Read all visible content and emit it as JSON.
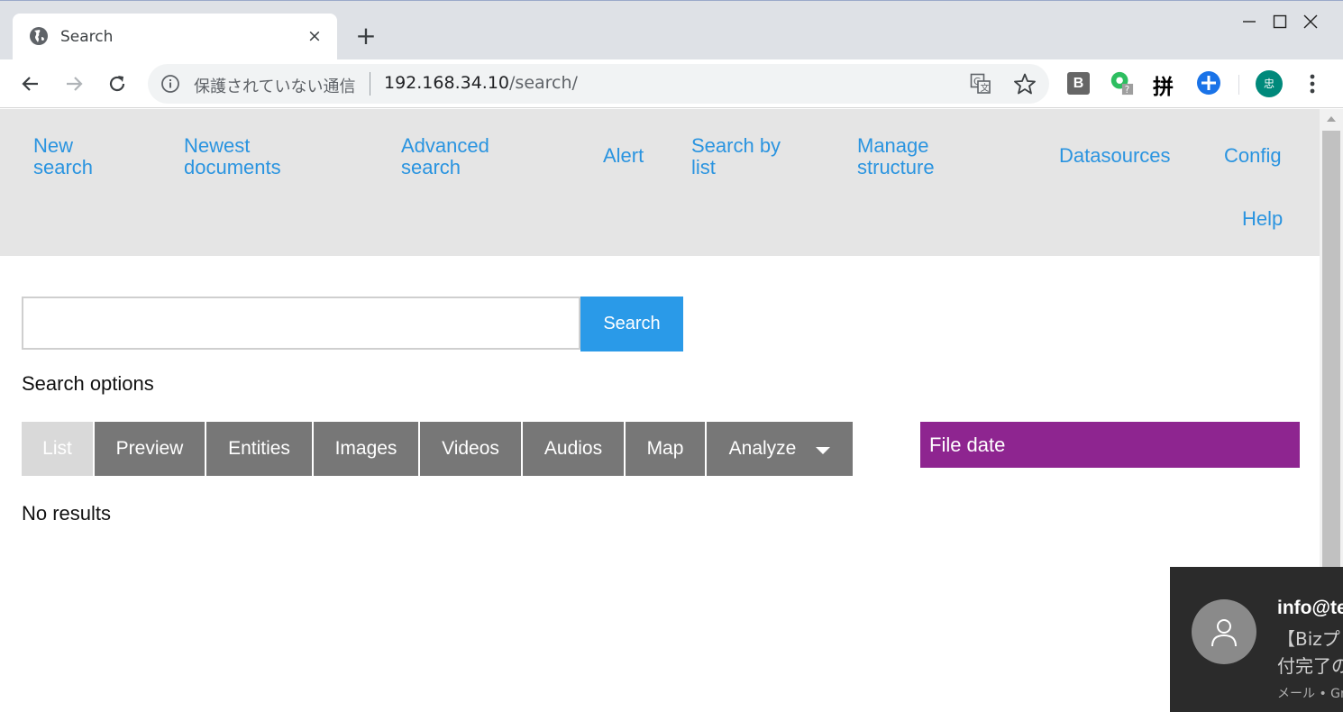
{
  "browser": {
    "tab_title": "Search",
    "tab_close": "×",
    "new_tab": "+",
    "security_label": "保護されていない通信",
    "url_host": "192.168.34.10",
    "url_path": "/search/",
    "extension_b_label": "B",
    "extension_pinyin_label": "拼",
    "profile_initial": "忠"
  },
  "nav": {
    "new_search": [
      "New",
      "search"
    ],
    "newest_documents": [
      "Newest",
      "documents"
    ],
    "advanced_search": [
      "Advanced",
      "search"
    ],
    "alert": "Alert",
    "search_by_list": [
      "Search by",
      "list"
    ],
    "manage_structure": [
      "Manage",
      "structure"
    ],
    "datasources": "Datasources",
    "config": "Config",
    "help": "Help"
  },
  "search": {
    "input_value": "",
    "button_label": "Search",
    "options_label": "Search options"
  },
  "view_tabs": [
    "List",
    "Preview",
    "Entities",
    "Images",
    "Videos",
    "Audios",
    "Map",
    "Analyze"
  ],
  "active_view": "List",
  "facet": {
    "title": "File date",
    "color": "#8e2590"
  },
  "results": {
    "message": "No results"
  },
  "notification": {
    "sender": "info@te",
    "line1": "【Bizプリ",
    "line2": "付完了の",
    "source": "メール • Gm"
  },
  "colors": {
    "link": "#2a94e0",
    "accent": "#2a9ae8",
    "tab_bg": "#777777"
  }
}
